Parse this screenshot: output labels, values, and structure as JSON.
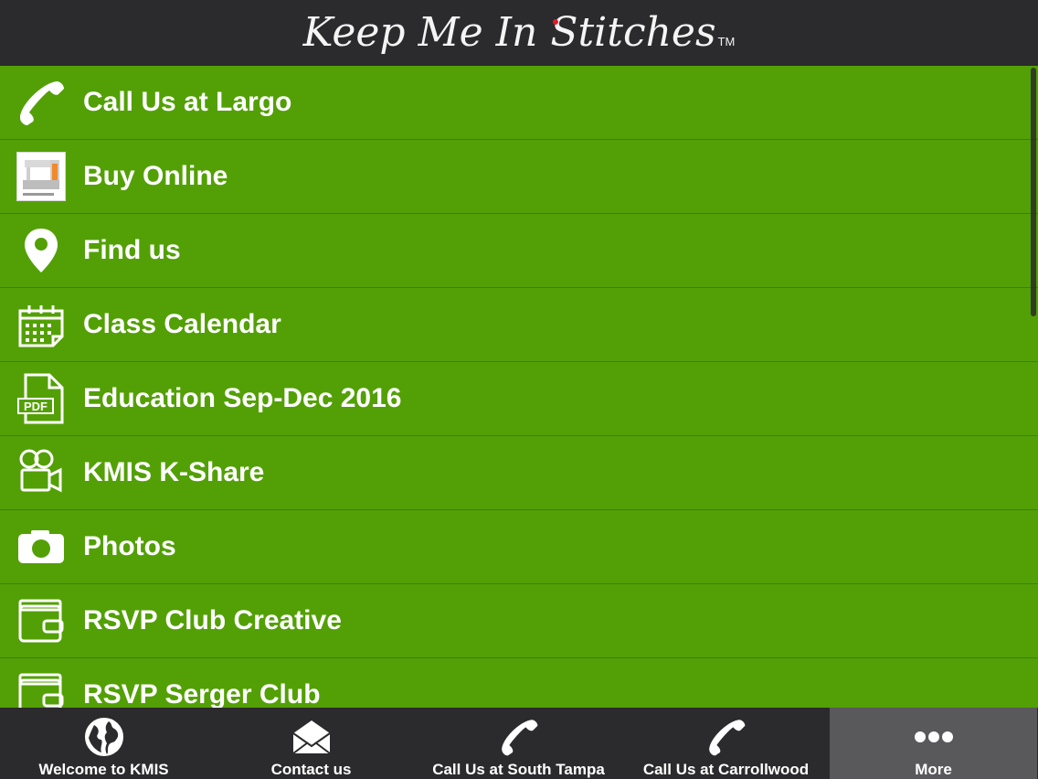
{
  "header": {
    "logo_text": "Keep Me In Stitches",
    "trademark": "TM"
  },
  "menu": {
    "items": [
      {
        "label": "Call Us at Largo",
        "icon": "phone-icon"
      },
      {
        "label": "Buy Online",
        "icon": "sewing-machine-thumbnail"
      },
      {
        "label": "Find us",
        "icon": "map-pin-icon"
      },
      {
        "label": "Class Calendar",
        "icon": "calendar-icon"
      },
      {
        "label": "Education Sep-Dec 2016",
        "icon": "pdf-icon",
        "icon_text": "PDF"
      },
      {
        "label": "KMIS K-Share",
        "icon": "video-camera-icon"
      },
      {
        "label": "Photos",
        "icon": "camera-icon"
      },
      {
        "label": "RSVP Club Creative",
        "icon": "wallet-form-icon"
      },
      {
        "label": "RSVP Serger Club",
        "icon": "wallet-form-icon"
      }
    ]
  },
  "tabbar": {
    "tabs": [
      {
        "label": "Welcome to KMIS",
        "icon": "globe-icon",
        "active": false
      },
      {
        "label": "Contact us",
        "icon": "envelope-icon",
        "active": false
      },
      {
        "label": "Call Us at South Tampa",
        "icon": "phone-icon",
        "active": false
      },
      {
        "label": "Call Us at Carrollwood",
        "icon": "phone-icon",
        "active": false
      },
      {
        "label": "More",
        "icon": "more-dots-icon",
        "active": true
      }
    ]
  },
  "colors": {
    "list_background": "#53a006",
    "header_background": "#2b2a2c",
    "tabbar_background": "#2b2a2c",
    "active_tab_background": "#59585b",
    "logo_accent": "#e31b23"
  }
}
